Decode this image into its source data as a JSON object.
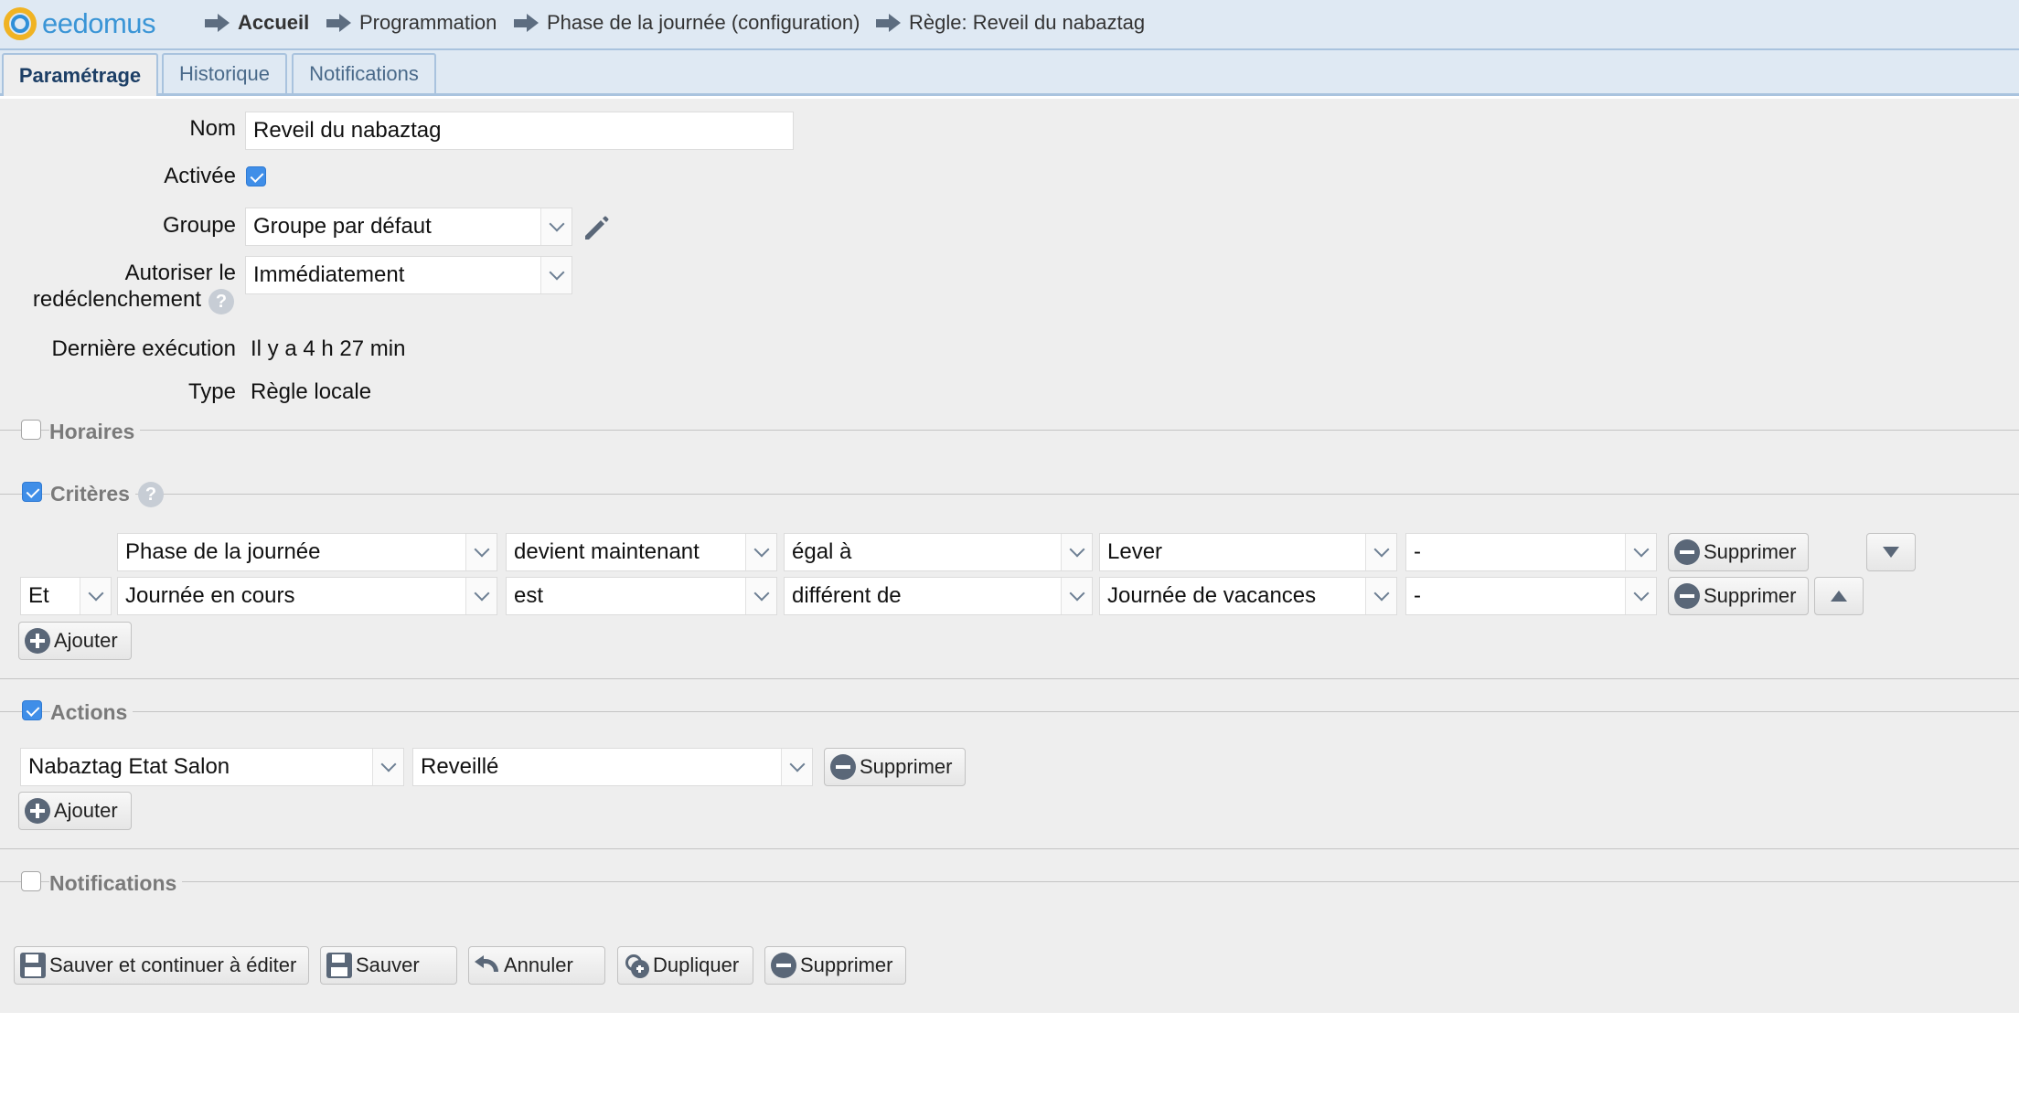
{
  "app": {
    "logo_text": "eedomus"
  },
  "breadcrumb": [
    {
      "label": "Accueil"
    },
    {
      "label": "Programmation"
    },
    {
      "label": "Phase de la journée (configuration)"
    },
    {
      "label": "Règle: Reveil du nabaztag"
    }
  ],
  "tabs": [
    {
      "label": "Paramétrage",
      "active": true
    },
    {
      "label": "Historique",
      "active": false
    },
    {
      "label": "Notifications",
      "active": false
    }
  ],
  "form": {
    "nom": {
      "label": "Nom",
      "value": "Reveil du nabaztag"
    },
    "activee": {
      "label": "Activée",
      "checked": true
    },
    "groupe": {
      "label": "Groupe",
      "value": "Groupe par défaut"
    },
    "redeclenchement": {
      "label_line1": "Autoriser le",
      "label_line2": "redéclenchement",
      "value": "Immédiatement"
    },
    "derniere_execution": {
      "label": "Dernière exécution",
      "value": "Il y a 4 h 27 min"
    },
    "type": {
      "label": "Type",
      "value": "Règle locale"
    }
  },
  "sections": {
    "horaires": {
      "title": "Horaires",
      "checked": false
    },
    "criteres": {
      "title": "Critères",
      "checked": true
    },
    "actions": {
      "title": "Actions",
      "checked": true
    },
    "notifications": {
      "title": "Notifications",
      "checked": false
    }
  },
  "criteria": [
    {
      "connector": "",
      "device": "Phase de la journée",
      "trigger": "devient maintenant",
      "operator": "égal à",
      "value": "Lever",
      "extra": "-",
      "remove_label": "Supprimer",
      "move": "down"
    },
    {
      "connector": "Et",
      "device": "Journée en cours",
      "trigger": "est",
      "operator": "différent de",
      "value": "Journée de vacances",
      "extra": "-",
      "remove_label": "Supprimer",
      "move": "up"
    }
  ],
  "criteria_add_label": "Ajouter",
  "actions": [
    {
      "device": "Nabaztag Etat Salon",
      "value": "Reveillé",
      "remove_label": "Supprimer"
    }
  ],
  "actions_add_label": "Ajouter",
  "footer_buttons": {
    "save_continue": "Sauver et continuer à éditer",
    "save": "Sauver",
    "cancel": "Annuler",
    "duplicate": "Dupliquer",
    "delete": "Supprimer"
  },
  "colors": {
    "accent": "#3f8ee8",
    "header_bg": "#dfe9f3",
    "content_bg": "#eeeeee"
  }
}
